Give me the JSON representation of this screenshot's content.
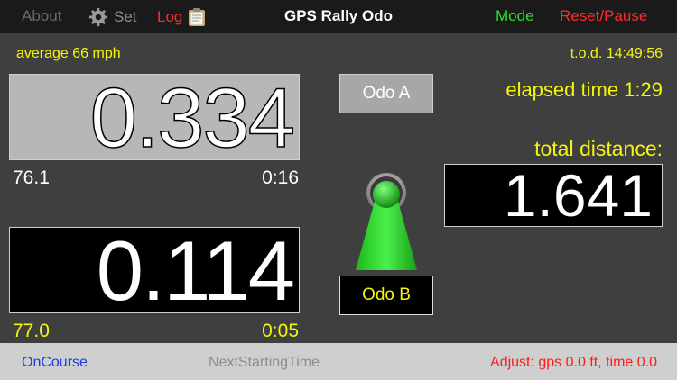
{
  "topbar": {
    "about_label": "About",
    "set_label": "Set",
    "log_label": "Log",
    "title": "GPS Rally Odo",
    "mode_label": "Mode",
    "reset_label": "Reset/Pause"
  },
  "status": {
    "average": "average 66 mph",
    "tod": "t.o.d. 14:49:56",
    "elapsed": "elapsed time 1:29",
    "total_label": "total distance:",
    "total_value": "1.641"
  },
  "odo_a": {
    "value": "0.334",
    "speed": "76.1",
    "time": "0:16",
    "button_label": "Odo A"
  },
  "odo_b": {
    "value": "0.114",
    "speed": "77.0",
    "time": "0:05",
    "button_label": "Odo B"
  },
  "bottombar": {
    "oncourse_label": "OnCourse",
    "nextstart_label": "NextStartingTime",
    "adjust_label": "Adjust: gps 0.0 ft, time 0.0"
  },
  "colors": {
    "background": "#3f3f3f",
    "accent_yellow": "#f5f50a",
    "mode_green": "#2ee02e",
    "alert_red": "#ff2b2b",
    "link_blue": "#1a3ee0"
  },
  "icons": {
    "set": "gear-icon",
    "log": "clipboard-icon",
    "selector": "lever-knob-icon"
  }
}
